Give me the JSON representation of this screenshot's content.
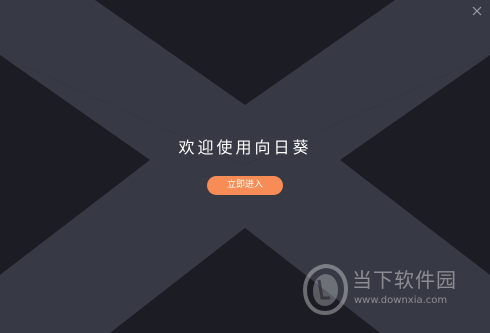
{
  "window": {
    "background_color": "#1c1d24",
    "band_color": "#373944",
    "close_icon": "close-icon"
  },
  "welcome": {
    "title": "欢迎使用向日葵",
    "enter_button": "立即进入",
    "accent_color": "#f78c56"
  },
  "watermark": {
    "brand": "当下软件园",
    "url": "www.downxia.com"
  }
}
